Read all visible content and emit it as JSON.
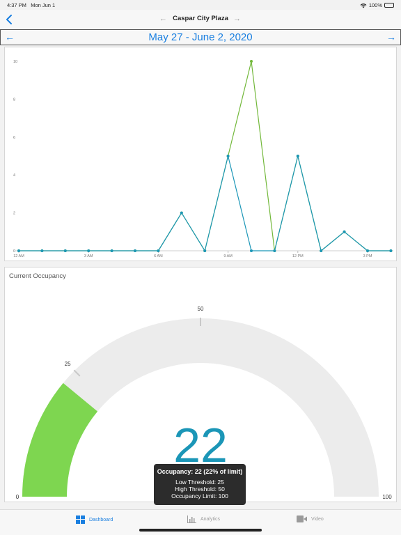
{
  "status_bar": {
    "time": "4:37 PM",
    "date": "Mon Jun 1",
    "battery": "100%"
  },
  "nav": {
    "title": "Caspar City Plaza"
  },
  "date_range": {
    "label": "May 27 - June 2, 2020"
  },
  "chart_data": {
    "type": "line",
    "title": "",
    "xlabel": "",
    "ylabel": "",
    "x": [
      "12 AM",
      "1 AM",
      "2 AM",
      "3 AM",
      "4 AM",
      "5 AM",
      "6 AM",
      "7 AM",
      "8 AM",
      "9 AM",
      "10 AM",
      "11 AM",
      "12 PM",
      "1 PM",
      "2 PM",
      "3 PM",
      "4 PM"
    ],
    "x_tick_labels": [
      "12 AM",
      "3 AM",
      "6 AM",
      "9 AM",
      "12 PM",
      "3 PM"
    ],
    "y_tick_labels": [
      "0",
      "2",
      "4",
      "6",
      "8",
      "10"
    ],
    "ylim": [
      0,
      10
    ],
    "grid": false,
    "series": [
      {
        "color": "#72b83a",
        "values": [
          0,
          0,
          0,
          0,
          0,
          0,
          0,
          2,
          0,
          5,
          10,
          0,
          5,
          0,
          1,
          0,
          0
        ]
      },
      {
        "color": "#1b96b7",
        "values": [
          0,
          0,
          0,
          0,
          0,
          0,
          0,
          2,
          0,
          5,
          0,
          0,
          5,
          0,
          1,
          0,
          0
        ]
      }
    ]
  },
  "gauge": {
    "title": "Current Occupancy",
    "value": 22,
    "value_label": "22",
    "min": 0,
    "max": 100,
    "min_label": "0",
    "max_label": "100",
    "low_threshold": 25,
    "high_threshold": 50,
    "low_label": "25",
    "high_label": "50",
    "fill_color": "#7ed650",
    "track_color": "#ececec",
    "value_color": "#1b96b7"
  },
  "tooltip": {
    "title": "Occupancy: 22 (22% of limit)",
    "low": "Low Threshold: 25",
    "high": "High Threshold: 50",
    "limit": "Occupancy Limit: 100"
  },
  "tabs": [
    {
      "label": "Dashboard",
      "icon": "dashboard-icon",
      "active": true
    },
    {
      "label": "Analytics",
      "icon": "analytics-icon",
      "active": false
    },
    {
      "label": "Video",
      "icon": "video-icon",
      "active": false
    }
  ]
}
